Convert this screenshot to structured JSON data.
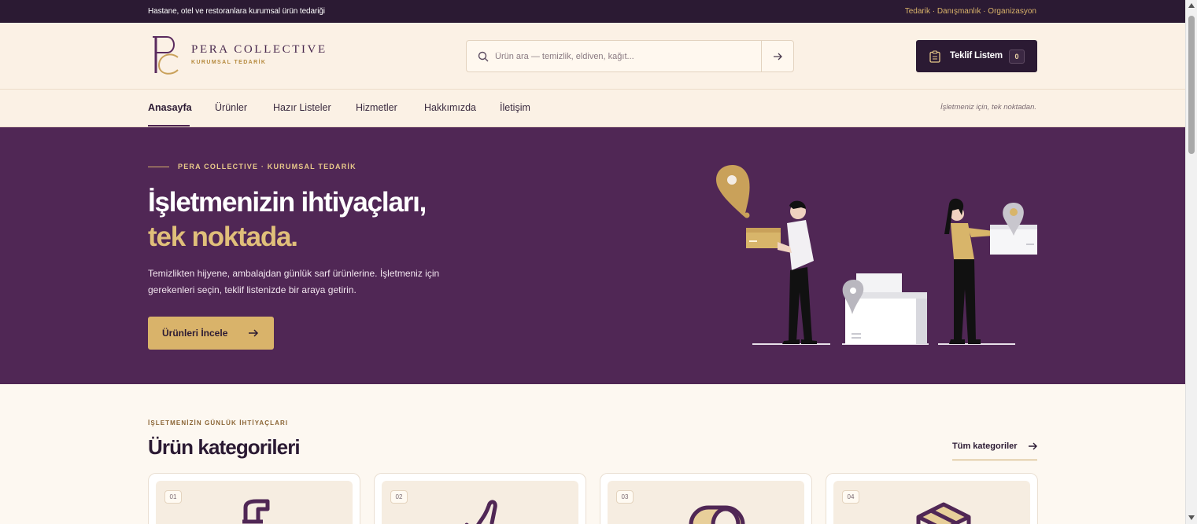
{
  "topbar": {
    "left_text": "Hastane, otel ve restoranlara kurumsal ürün tedariği",
    "right_text": "Tedarik · Danışmanlık · Organizasyon"
  },
  "header": {
    "brand": "PERA COLLECTIVE",
    "brand_sub": "KURUMSAL TEDARİK",
    "search": {
      "placeholder": "Ürün ara — temizlik, eldiven, kağıt..."
    },
    "quote": {
      "label": "Teklif Listem",
      "count": "0"
    }
  },
  "nav": {
    "items": [
      {
        "label": "Anasayfa",
        "active": true
      },
      {
        "label": "Ürünler"
      },
      {
        "label": "Hazır Listeler"
      },
      {
        "label": "Hizmetler"
      },
      {
        "label": "Hakkımızda"
      },
      {
        "label": "İletişim"
      }
    ],
    "tagline": "İşletmeniz için, tek noktadan."
  },
  "hero": {
    "eyebrow": "PERA COLLECTIVE · KURUMSAL TEDARİK",
    "title_line1": "İşletmenizin ihtiyaçları,",
    "title_line2": "tek noktada.",
    "description": "Temizlikten hijyene, ambalajdan günlük sarf ürünlerine. İşletmeniz için gerekenleri seçin, teklif listenizde bir araya getirin.",
    "cta_label": "Ürünleri İncele"
  },
  "categories": {
    "eyebrow": "İŞLETMENİZİN GÜNLÜK İHTİYAÇLARI",
    "title": "Ürün kategorileri",
    "all_label": "Tüm kategoriler",
    "cards": [
      {
        "num": "01",
        "icon": "spray-bottle-icon"
      },
      {
        "num": "02",
        "icon": "glove-icon"
      },
      {
        "num": "03",
        "icon": "paper-roll-icon"
      },
      {
        "num": "04",
        "icon": "box-icon"
      }
    ]
  },
  "colors": {
    "primary": "#502755",
    "dark": "#2b1a33",
    "accent": "#d9b36a",
    "background": "#fdf8f1"
  }
}
